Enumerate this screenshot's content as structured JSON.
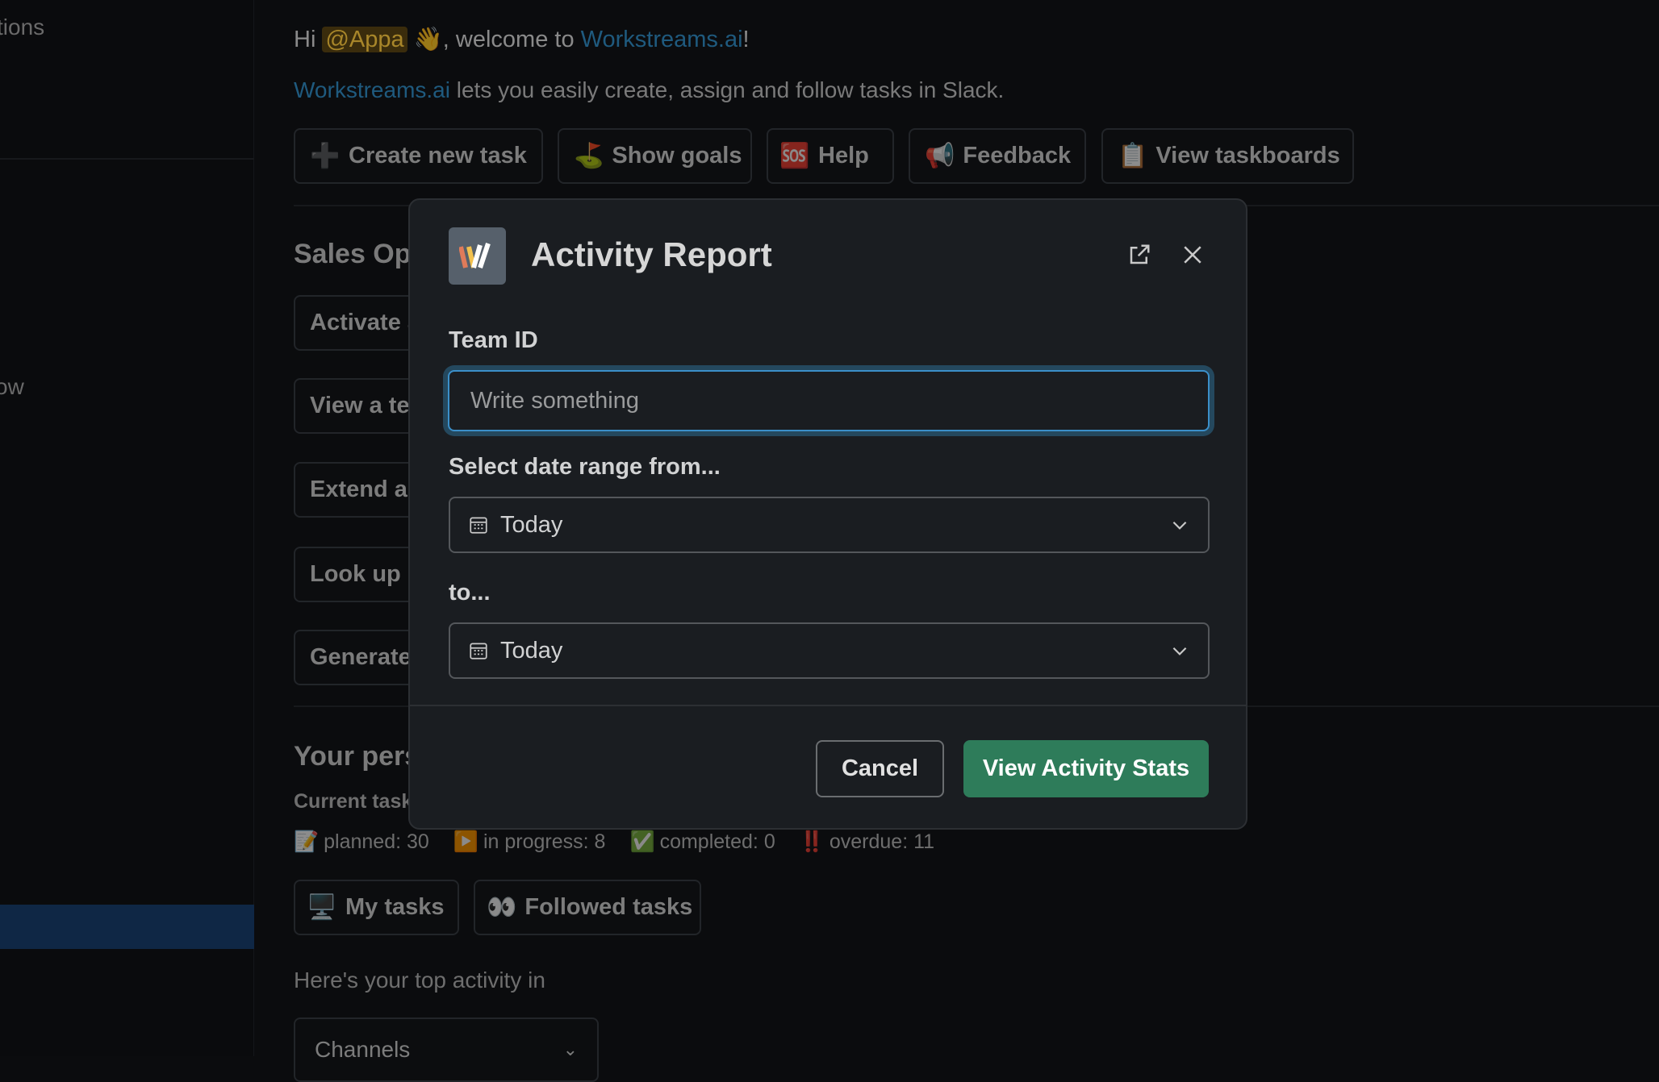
{
  "sidebar": {
    "items": [
      {
        "label": "tions"
      },
      {
        "label": "ow"
      }
    ]
  },
  "welcome": {
    "hi": "Hi",
    "mention": "@Appa",
    "wave": "👋",
    "welcome_to": ", welcome to",
    "brand": "Workstreams.ai",
    "exclaim": "!"
  },
  "intro": {
    "brand": "Workstreams.ai",
    "text": " lets you easily create, assign and follow tasks in Slack."
  },
  "quick_actions": [
    {
      "icon": "➕",
      "label": "Create new task"
    },
    {
      "icon": "⛳",
      "label": "Show goals"
    },
    {
      "icon": "🆘",
      "label": "Help"
    },
    {
      "icon": "📢",
      "label": "Feedback"
    },
    {
      "icon": "📋",
      "label": "View taskboards"
    }
  ],
  "sales": {
    "heading": "Sales Op",
    "actions": [
      "Activate a",
      "View a te",
      "Extend a",
      "Look up u",
      "Generate"
    ]
  },
  "personal": {
    "heading": "Your pers",
    "current": "Current task",
    "stats": [
      {
        "icon": "📝",
        "label": "planned: 30"
      },
      {
        "icon": "▶️",
        "label": "in progress: 8"
      },
      {
        "icon": "✅",
        "label": "completed: 0"
      },
      {
        "icon": "‼️",
        "label": "overdue: 11"
      }
    ],
    "buttons": [
      {
        "icon": "🖥️",
        "label": "My tasks"
      },
      {
        "icon": "👀",
        "label": "Followed tasks"
      }
    ],
    "activity": "Here's your top activity in",
    "select": "Channels"
  },
  "modal": {
    "title": "Activity Report",
    "logo": "W",
    "team_id_label": "Team ID",
    "team_id_placeholder": "Write something",
    "from_label": "Select date range from...",
    "from_value": "Today",
    "to_label": "to...",
    "to_value": "Today",
    "cancel": "Cancel",
    "submit": "View Activity Stats",
    "colors": {
      "primary": "#2e7c5a",
      "focus": "#3b8fc9"
    }
  }
}
